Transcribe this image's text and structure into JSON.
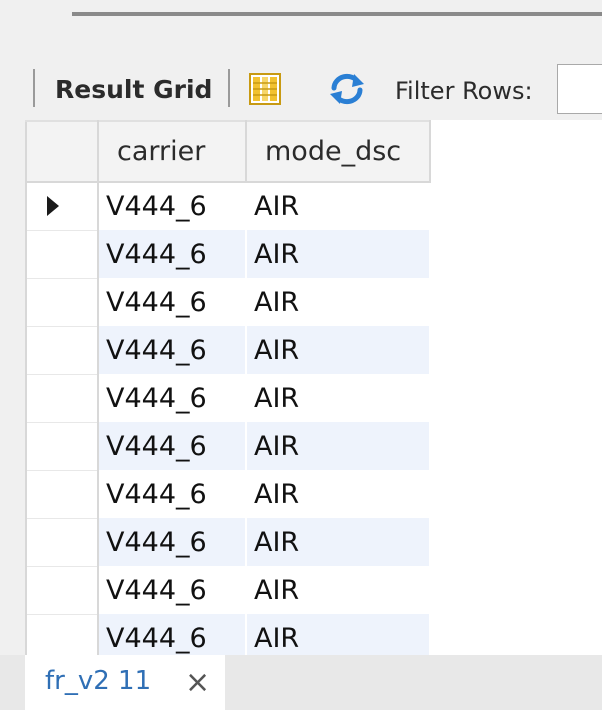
{
  "toolbar": {
    "result_grid_label": "Result Grid",
    "filter_label": "Filter Rows:",
    "filter_value": "",
    "icons": {
      "grid_layout": "grid-layout-icon",
      "refresh": "refresh-icon"
    },
    "colors": {
      "grid_icon_yellow": "#f2c230",
      "refresh_blue": "#2a7fd4"
    }
  },
  "grid": {
    "columns": [
      "carrier",
      "mode_dsc"
    ],
    "selected_row": 0,
    "rows": [
      [
        "V444_6",
        "AIR"
      ],
      [
        "V444_6",
        "AIR"
      ],
      [
        "V444_6",
        "AIR"
      ],
      [
        "V444_6",
        "AIR"
      ],
      [
        "V444_6",
        "AIR"
      ],
      [
        "V444_6",
        "AIR"
      ],
      [
        "V444_6",
        "AIR"
      ],
      [
        "V444_6",
        "AIR"
      ],
      [
        "V444_6",
        "AIR"
      ],
      [
        "V444_6",
        "AIR"
      ]
    ],
    "colors": {
      "alt_row": "#eef3fc"
    }
  },
  "tabs": [
    {
      "label": "fr_v2 11",
      "close": "×"
    }
  ]
}
